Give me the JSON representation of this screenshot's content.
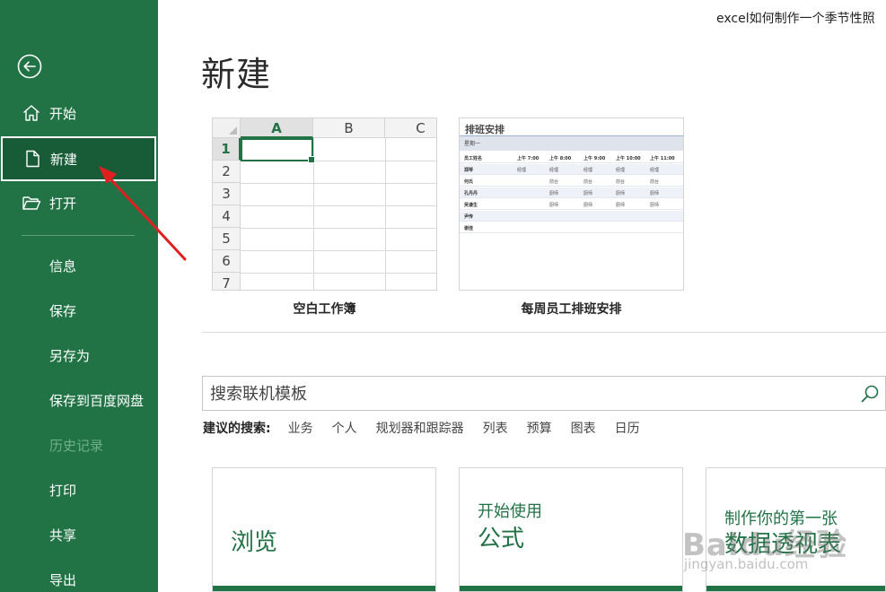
{
  "window": {
    "doc_title": "excel如何制作一个季节性照"
  },
  "sidebar": {
    "back_icon": "back-arrow-icon",
    "items": [
      {
        "label": "开始",
        "icon": "home-icon"
      },
      {
        "label": "新建",
        "icon": "new-document-icon",
        "active": true
      },
      {
        "label": "打开",
        "icon": "open-folder-icon"
      }
    ],
    "items2": [
      {
        "label": "信息"
      },
      {
        "label": "保存"
      },
      {
        "label": "另存为"
      },
      {
        "label": "保存到百度网盘"
      },
      {
        "label": "历史记录",
        "disabled": true
      },
      {
        "label": "打印"
      },
      {
        "label": "共享"
      },
      {
        "label": "导出"
      }
    ]
  },
  "main": {
    "title": "新建",
    "templates": [
      {
        "caption": "空白工作簿",
        "columns": [
          "A",
          "B",
          "C"
        ],
        "rows": [
          "1",
          "2",
          "3",
          "4",
          "5",
          "6",
          "7"
        ]
      },
      {
        "caption": "每周员工排班安排",
        "thumb_title": "排班安排",
        "band_label": "星期一",
        "header": [
          "员工姓名",
          "上午 7:00",
          "上午 8:00",
          "上午 9:00",
          "上午 10:00",
          "上午 11:00"
        ],
        "rows": [
          [
            "郑琴",
            "经理",
            "经理",
            "经理",
            "经理",
            "经理"
          ],
          [
            "何氏",
            "",
            "前台",
            "前台",
            "前台",
            "前台"
          ],
          [
            "孔丹丹",
            "",
            "厨师",
            "厨师",
            "厨师",
            "厨师"
          ],
          [
            "吴谦生",
            "",
            "厨师",
            "厨师",
            "厨师",
            "厨师"
          ],
          [
            "尹传",
            "",
            "",
            "",
            "",
            ""
          ],
          [
            "谢佳",
            "",
            "",
            "",
            "",
            ""
          ]
        ]
      }
    ],
    "search": {
      "placeholder": "搜索联机模板",
      "value": "",
      "icon": "search-icon"
    },
    "suggested": {
      "label": "建议的搜索:",
      "links": [
        "业务",
        "个人",
        "规划器和跟踪器",
        "列表",
        "预算",
        "图表",
        "日历"
      ]
    },
    "cards": [
      {
        "line1": "",
        "line2": "浏览"
      },
      {
        "line1": "开始使用",
        "line2": "公式"
      },
      {
        "line1": "制作你的第一张",
        "line2": "数据透视表"
      }
    ]
  },
  "overlay": {
    "watermark": "Baidu经验",
    "watermark_sub": "jingyan.baidu.com",
    "annotation": "red-arrow-pointing-to-new"
  },
  "colors": {
    "sidebar_bg": "#217346",
    "sidebar_active": "#185c37",
    "accent_green": "#217346",
    "annotation_red": "#e02020"
  }
}
